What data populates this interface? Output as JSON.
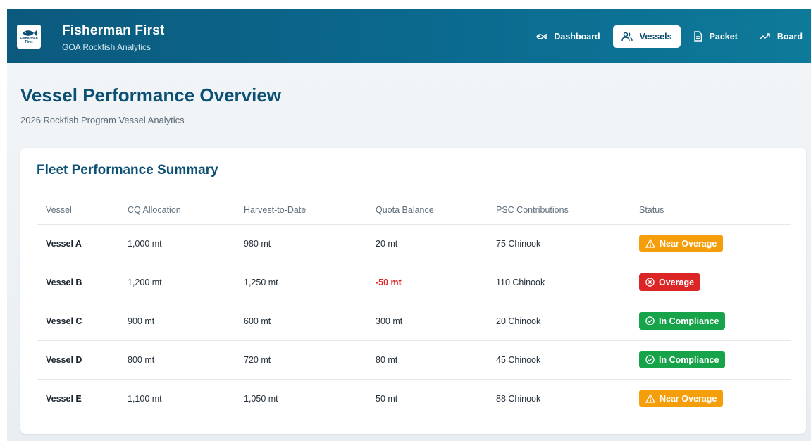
{
  "header": {
    "logo_text": "Fisherman First",
    "brand_title": "Fisherman First",
    "brand_subtitle": "GOA Rockfish Analytics",
    "nav": [
      {
        "label": "Dashboard",
        "icon": "fish-icon",
        "active": false
      },
      {
        "label": "Vessels",
        "icon": "users-icon",
        "active": true
      },
      {
        "label": "Packet",
        "icon": "document-icon",
        "active": false
      },
      {
        "label": "Board",
        "icon": "trending-up-icon",
        "active": false
      }
    ]
  },
  "page": {
    "title": "Vessel Performance Overview",
    "subtitle": "2026 Rockfish Program Vessel Analytics"
  },
  "summary": {
    "title": "Fleet Performance Summary",
    "columns": [
      "Vessel",
      "CQ Allocation",
      "Harvest-to-Date",
      "Quota Balance",
      "PSC Contributions",
      "Status"
    ],
    "rows": [
      {
        "vessel": "Vessel A",
        "cq": "1,000 mt",
        "harvest": "980 mt",
        "balance": "20 mt",
        "psc": "75 Chinook",
        "status": "Near Overage",
        "status_type": "warning"
      },
      {
        "vessel": "Vessel B",
        "cq": "1,200 mt",
        "harvest": "1,250 mt",
        "balance": "-50 mt",
        "psc": "110 Chinook",
        "status": "Overage",
        "status_type": "danger"
      },
      {
        "vessel": "Vessel C",
        "cq": "900 mt",
        "harvest": "600 mt",
        "balance": "300 mt",
        "psc": "20 Chinook",
        "status": "In Compliance",
        "status_type": "success"
      },
      {
        "vessel": "Vessel D",
        "cq": "800 mt",
        "harvest": "720 mt",
        "balance": "80 mt",
        "psc": "45 Chinook",
        "status": "In Compliance",
        "status_type": "success"
      },
      {
        "vessel": "Vessel E",
        "cq": "1,100 mt",
        "harvest": "1,050 mt",
        "balance": "50 mt",
        "psc": "88 Chinook",
        "status": "Near Overage",
        "status_type": "warning"
      }
    ]
  },
  "colors": {
    "brand": "#0b5a7e",
    "heading": "#0b4f73",
    "warning": "#f59e0b",
    "danger": "#dc2626",
    "success": "#16a34a"
  }
}
